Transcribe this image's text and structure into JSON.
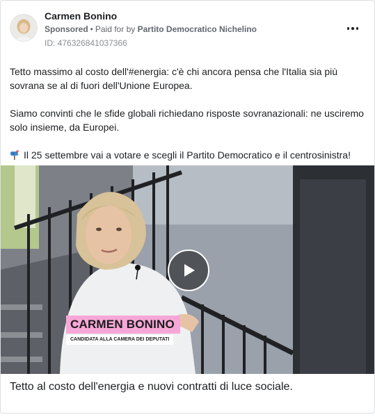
{
  "post": {
    "author": "Carmen Bonino",
    "sponsored_label": "Sponsored",
    "paid_prefix": "Paid for by",
    "payer": "Partito Democratico Nichelino",
    "ad_id": "ID: 476326841037366",
    "paragraphs": [
      "Tetto massimo al costo dell'#energia: c'è chi ancora pensa che l'Italia sia più sovrana se al di fuori dell'Unione Europea.",
      "Siamo convinti che le sfide globali richiedano risposte sovranazionali: ne usciremo solo insieme, da Europei.",
      "Il 25 settembre vai a votare e scegli il Partito Democratico e il centrosinistra!"
    ],
    "paragraph_3_icon": "mailbox-icon"
  },
  "video": {
    "name_tag": "CARMEN BONINO",
    "role_tag": "CANDIDATA ALLA CAMERA DEI DEPUTATI",
    "name_tag_color": "#f7a7d7",
    "play_icon": "play-icon"
  },
  "caption": "Tetto al costo dell'energia e nuovi contratti di luce sociale.",
  "menu_icon": "more-options-icon"
}
